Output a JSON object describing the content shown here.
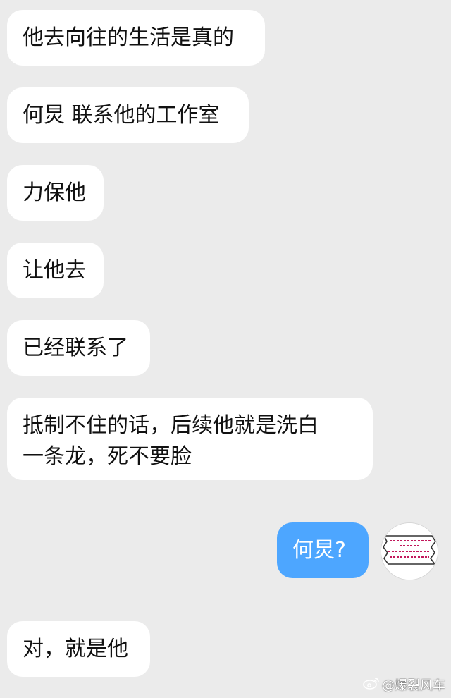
{
  "messages": [
    {
      "side": "in",
      "text": "他去向往的生活是真的"
    },
    {
      "side": "in",
      "text": "何炅 联系他的工作室"
    },
    {
      "side": "in",
      "text": "力保他"
    },
    {
      "side": "in",
      "text": "让他去"
    },
    {
      "side": "in",
      "text": "已经联系了"
    },
    {
      "side": "in",
      "text": "抵制不住的话，后续他就是洗白\n一条龙，死不要脸"
    },
    {
      "side": "out",
      "text": "何炅?"
    },
    {
      "side": "in",
      "text": "对，就是他"
    }
  ],
  "watermark": {
    "text": "@爆裂风车",
    "icon": "weibo-icon"
  },
  "colors": {
    "background": "#ebebeb",
    "incoming_bubble": "#ffffff",
    "outgoing_bubble": "#4da6ff"
  }
}
